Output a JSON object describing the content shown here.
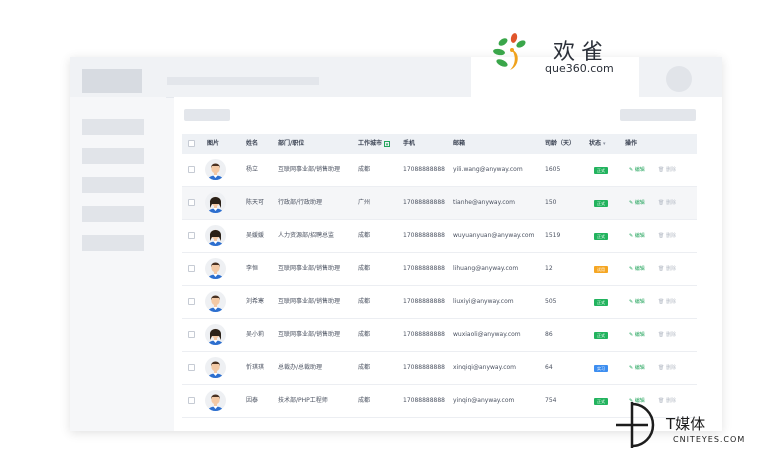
{
  "brand": {
    "name": "欢雀",
    "domain": "que360.com"
  },
  "watermark": {
    "name": "T媒体",
    "domain": "CNITEYES.COM"
  },
  "table": {
    "headers": {
      "photo": "图片",
      "name": "姓名",
      "dept": "部门/职位",
      "city": "工作城市",
      "phone": "手机",
      "email": "邮箱",
      "tenure": "司龄（天）",
      "status": "状态",
      "actions": "操作"
    },
    "edit_label": "编辑",
    "delete_label": "删除",
    "rows": [
      {
        "name": "杨立",
        "dept": "互联网事业部/销售助理",
        "city": "成都",
        "phone": "17088888888",
        "email": "yili.wang@anyway.com",
        "tenure": "1605",
        "status": "正式",
        "status_color": "#22b35e",
        "gender": "male"
      },
      {
        "name": "陈天可",
        "dept": "行政部/行政助理",
        "city": "广州",
        "phone": "17088888888",
        "email": "tianhe@anyway.com",
        "tenure": "150",
        "status": "正式",
        "status_color": "#22b35e",
        "gender": "female"
      },
      {
        "name": "吴媛媛",
        "dept": "人力资源部/招聘总监",
        "city": "成都",
        "phone": "17088888888",
        "email": "wuyuanyuan@anyway.com",
        "tenure": "1519",
        "status": "正式",
        "status_color": "#22b35e",
        "gender": "female"
      },
      {
        "name": "李恒",
        "dept": "互联网事业部/销售助理",
        "city": "成都",
        "phone": "17088888888",
        "email": "lihuang@anyway.com",
        "tenure": "12",
        "status": "试用",
        "status_color": "#f5a623",
        "gender": "male"
      },
      {
        "name": "刘希寒",
        "dept": "互联网事业部/销售助理",
        "city": "成都",
        "phone": "17088888888",
        "email": "liuxiyi@anyway.com",
        "tenure": "505",
        "status": "正式",
        "status_color": "#22b35e",
        "gender": "male"
      },
      {
        "name": "吴小莉",
        "dept": "互联网事业部/销售助理",
        "city": "成都",
        "phone": "17088888888",
        "email": "wuxiaoli@anyway.com",
        "tenure": "86",
        "status": "正式",
        "status_color": "#22b35e",
        "gender": "female"
      },
      {
        "name": "忻琪琪",
        "dept": "总裁办/总裁助理",
        "city": "成都",
        "phone": "17088888888",
        "email": "xinqiqi@anyway.com",
        "tenure": "64",
        "status": "实习",
        "status_color": "#3d8ef0",
        "gender": "male"
      },
      {
        "name": "因泰",
        "dept": "技术部/PHP工程师",
        "city": "成都",
        "phone": "17088888888",
        "email": "yinqin@anyway.com",
        "tenure": "754",
        "status": "正式",
        "status_color": "#22b35e",
        "gender": "male"
      }
    ]
  },
  "icons": {
    "checkbox": "checkbox-icon",
    "filter": "filter-icon",
    "edit": "pencil-icon",
    "delete": "trash-icon"
  }
}
